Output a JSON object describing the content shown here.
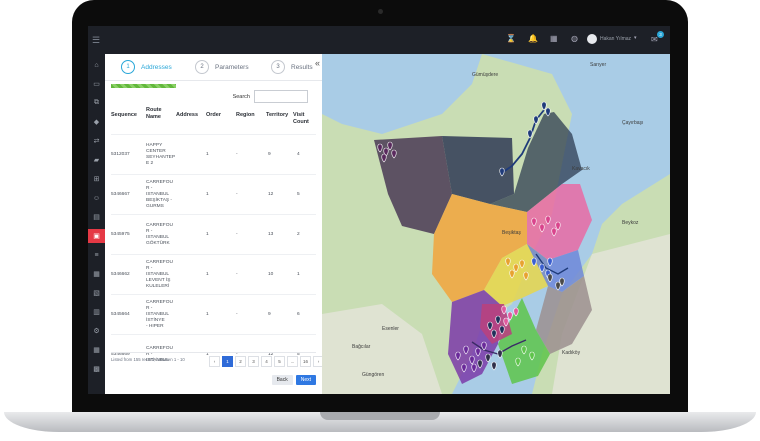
{
  "header": {
    "user_name": "Hakan Yılmaz",
    "notification_count": "3"
  },
  "sidebar": {
    "items": [
      "home",
      "monitor",
      "org",
      "tag",
      "route",
      "truck",
      "cart",
      "users",
      "doc",
      "map",
      "list",
      "calendar",
      "clipboard",
      "chart",
      "settings",
      "calendar2",
      "store"
    ],
    "active_index": 9
  },
  "wizard": {
    "steps": [
      {
        "number": "1",
        "label": "Addresses"
      },
      {
        "number": "2",
        "label": "Parameters"
      },
      {
        "number": "3",
        "label": "Results"
      }
    ],
    "active_step": 0,
    "progress": 0.3
  },
  "table": {
    "search_label": "Search",
    "columns": [
      "Sequence",
      "Route Name",
      "Address",
      "Order",
      "Region",
      "Territory",
      "Visit Count"
    ],
    "rows": [
      {
        "sequence": "5312037",
        "route_name": [
          "HAPPY",
          "CENTER",
          "SEYHANTEP",
          "E 2"
        ],
        "address": "",
        "order": "1",
        "region": "-",
        "territory": "9",
        "visit_count": "4"
      },
      {
        "sequence": "5346667",
        "route_name": [
          "CARREFOU",
          "R -",
          "ISTANBUL",
          "BEŞİKTAŞ -",
          "GURMS"
        ],
        "address": "",
        "order": "1",
        "region": "-",
        "territory": "12",
        "visit_count": "5"
      },
      {
        "sequence": "5345975",
        "route_name": [
          "CARREFOU",
          "R -",
          "ISTANBUL",
          "GÖKTÜRK"
        ],
        "address": "",
        "order": "1",
        "region": "-",
        "territory": "13",
        "visit_count": "2"
      },
      {
        "sequence": "5346662",
        "route_name": [
          "CARREFOU",
          "R -",
          "ISTANBUL",
          "LEVENT İŞ",
          "KULELERİ"
        ],
        "address": "",
        "order": "1",
        "region": "-",
        "territory": "10",
        "visit_count": "1"
      },
      {
        "sequence": "5345664",
        "route_name": [
          "CARREFOU",
          "R -",
          "ISTANBUL",
          "İSTİNYE",
          "- HIPER"
        ],
        "address": "",
        "order": "1",
        "region": "-",
        "territory": "9",
        "visit_count": "6"
      },
      {
        "sequence": "5346669",
        "route_name": [
          "CARREFOU",
          "R -",
          "ISTANBUL"
        ],
        "address": "",
        "order": "1",
        "region": "-",
        "territory": "12",
        "visit_count": "5"
      }
    ],
    "info": "Listed from 155 record, between 1 - 10",
    "pages": [
      "‹",
      "1",
      "2",
      "3",
      "4",
      "5",
      "...",
      "16",
      "›"
    ],
    "active_page": "1"
  },
  "buttons": {
    "back": "Back",
    "next": "Next"
  },
  "map": {
    "labels": [
      {
        "text": "Gümüşdere"
      },
      {
        "text": "Sarıyer"
      },
      {
        "text": "Çayırbaşı"
      },
      {
        "text": "Beykoz"
      },
      {
        "text": "Kavacık"
      },
      {
        "text": "Beşiktaş"
      },
      {
        "text": "Kadıköy"
      },
      {
        "text": "Güngören"
      },
      {
        "text": "Bağcılar"
      },
      {
        "text": "Esenler"
      }
    ]
  },
  "colors": {
    "topbar": "#1d2027",
    "accent": "#2aa7d8",
    "active_sidebar": "#e53945",
    "next_button": "#2f78e2",
    "territories": [
      "#4a3a55",
      "#2f3a55",
      "#e96aa3",
      "#f2a53c",
      "#e8d64a",
      "#6f87d8",
      "#9c8f8f",
      "#7b3aa8",
      "#5ec44a",
      "#b8417e"
    ]
  }
}
